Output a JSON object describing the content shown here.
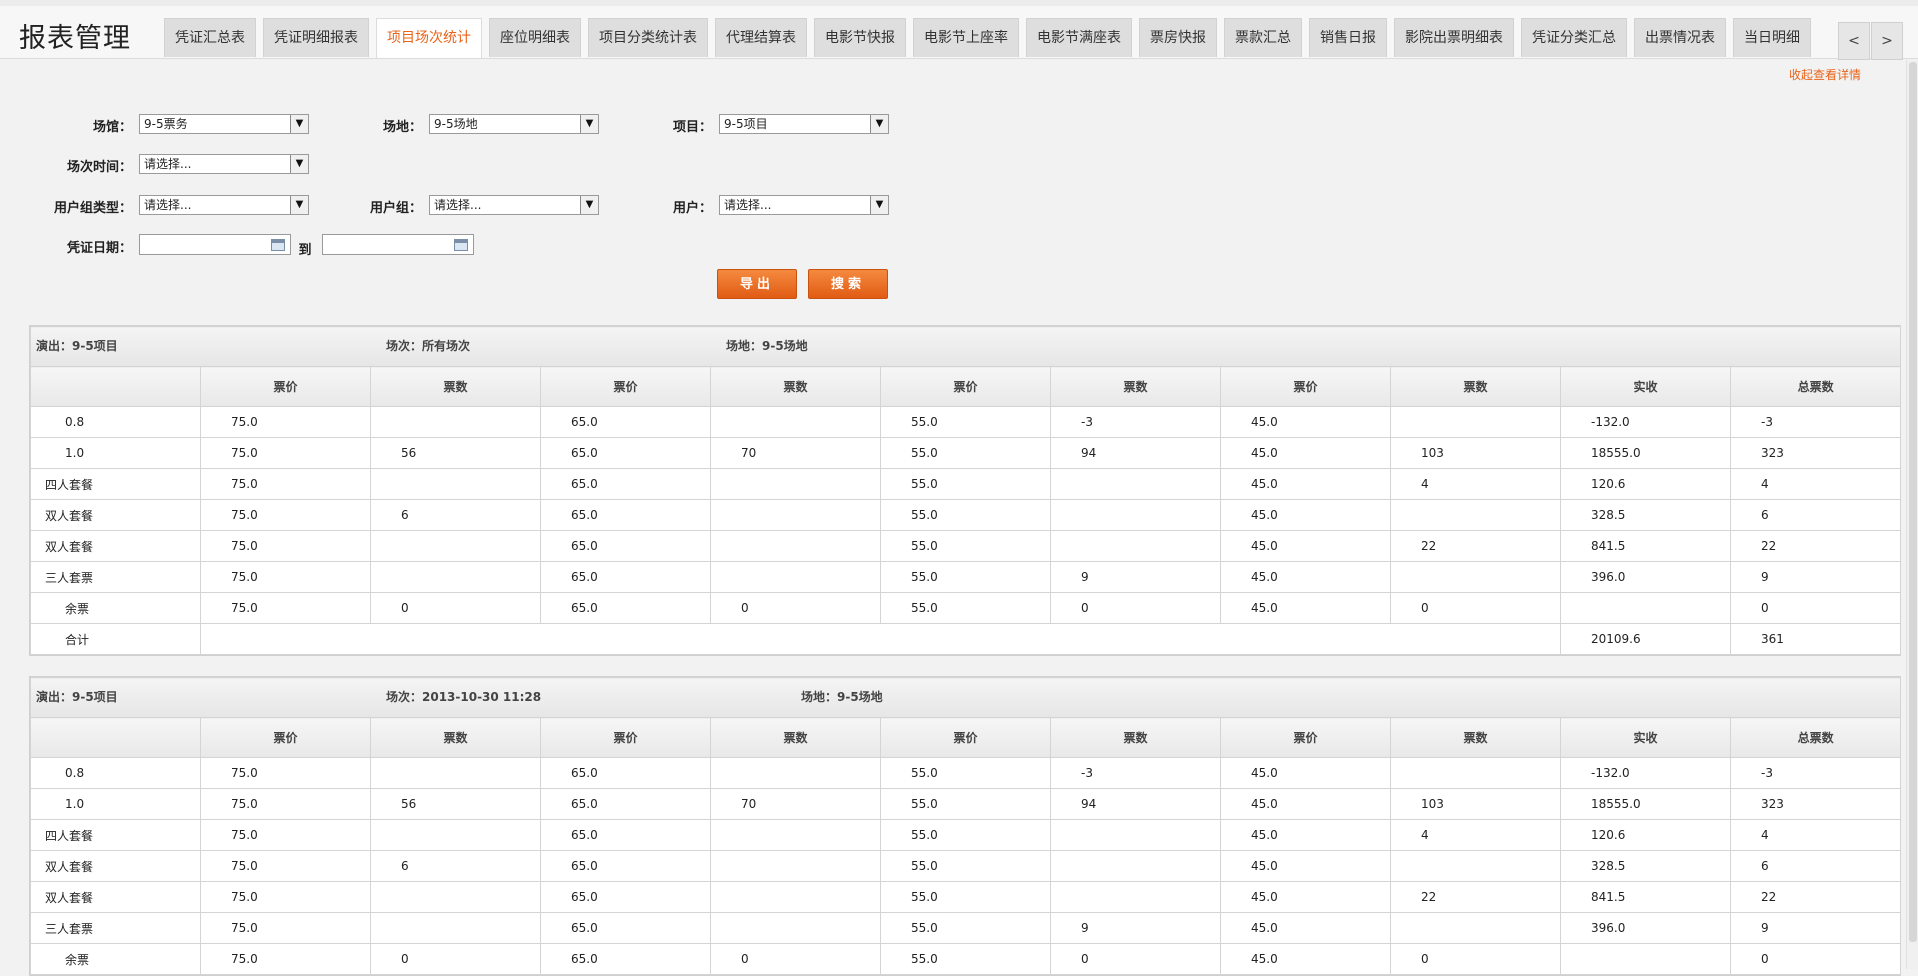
{
  "app_title": "报表管理",
  "tabs": [
    {
      "label": "凭证汇总表",
      "active": false
    },
    {
      "label": "凭证明细报表",
      "active": false
    },
    {
      "label": "项目场次统计",
      "active": true
    },
    {
      "label": "座位明细表",
      "active": false
    },
    {
      "label": "项目分类统计表",
      "active": false
    },
    {
      "label": "代理结算表",
      "active": false
    },
    {
      "label": "电影节快报",
      "active": false
    },
    {
      "label": "电影节上座率",
      "active": false
    },
    {
      "label": "电影节满座表",
      "active": false
    },
    {
      "label": "票房快报",
      "active": false
    },
    {
      "label": "票款汇总",
      "active": false
    },
    {
      "label": "销售日报",
      "active": false
    },
    {
      "label": "影院出票明细表",
      "active": false
    },
    {
      "label": "凭证分类汇总",
      "active": false
    },
    {
      "label": "出票情况表",
      "active": false
    },
    {
      "label": "当日明细",
      "active": false
    }
  ],
  "tab_prev": "<",
  "tab_next": ">",
  "toggle_link": "收起查看详情",
  "filters": {
    "venue_label": "场馆：",
    "venue_value": "9-5票务",
    "site_label": "场地：",
    "site_value": "9-5场地",
    "project_label": "项目：",
    "project_value": "9-5项目",
    "session_label": "场次时间：",
    "session_value": "请选择...",
    "usergroup_type_label": "用户组类型：",
    "usergroup_type_value": "请选择...",
    "usergroup_label": "用户组：",
    "usergroup_value": "请选择...",
    "user_label": "用户：",
    "user_value": "请选择...",
    "date_label": "凭证日期：",
    "date_to": "到",
    "date_from_value": "",
    "date_to_value": "",
    "export_button": "导出",
    "search_button": "搜索"
  },
  "columns": [
    "",
    "票价",
    "票数",
    "票价",
    "票数",
    "票价",
    "票数",
    "票价",
    "票数",
    "实收",
    "总票数"
  ],
  "reports": [
    {
      "show_label": "演出：9-5项目",
      "session_label": "场次：所有场次",
      "site_label": "场地：9-5场地",
      "rows": [
        [
          "0.8",
          "75.0",
          "",
          "65.0",
          "",
          "55.0",
          "-3",
          "45.0",
          "",
          "-132.0",
          "-3"
        ],
        [
          "1.0",
          "75.0",
          "56",
          "65.0",
          "70",
          "55.0",
          "94",
          "45.0",
          "103",
          "18555.0",
          "323"
        ],
        [
          "四人套餐",
          "75.0",
          "",
          "65.0",
          "",
          "55.0",
          "",
          "45.0",
          "4",
          "120.6",
          "4"
        ],
        [
          "双人套餐",
          "75.0",
          "6",
          "65.0",
          "",
          "55.0",
          "",
          "45.0",
          "",
          "328.5",
          "6"
        ],
        [
          "双人套餐",
          "75.0",
          "",
          "65.0",
          "",
          "55.0",
          "",
          "45.0",
          "22",
          "841.5",
          "22"
        ],
        [
          "三人套票",
          "75.0",
          "",
          "65.0",
          "",
          "55.0",
          "9",
          "45.0",
          "",
          "396.0",
          "9"
        ],
        [
          "余票",
          "75.0",
          "0",
          "65.0",
          "0",
          "55.0",
          "0",
          "45.0",
          "0",
          "",
          "0"
        ]
      ],
      "total": {
        "label": "合计",
        "amount": "20109.6",
        "count": "361"
      }
    },
    {
      "show_label": "演出：9-5项目",
      "session_label": "场次：2013-10-30 11:28",
      "site_label": "场地：9-5场地",
      "rows": [
        [
          "0.8",
          "75.0",
          "",
          "65.0",
          "",
          "55.0",
          "-3",
          "45.0",
          "",
          "-132.0",
          "-3"
        ],
        [
          "1.0",
          "75.0",
          "56",
          "65.0",
          "70",
          "55.0",
          "94",
          "45.0",
          "103",
          "18555.0",
          "323"
        ],
        [
          "四人套餐",
          "75.0",
          "",
          "65.0",
          "",
          "55.0",
          "",
          "45.0",
          "4",
          "120.6",
          "4"
        ],
        [
          "双人套餐",
          "75.0",
          "6",
          "65.0",
          "",
          "55.0",
          "",
          "45.0",
          "",
          "328.5",
          "6"
        ],
        [
          "双人套餐",
          "75.0",
          "",
          "65.0",
          "",
          "55.0",
          "",
          "45.0",
          "22",
          "841.5",
          "22"
        ],
        [
          "三人套票",
          "75.0",
          "",
          "65.0",
          "",
          "55.0",
          "9",
          "45.0",
          "",
          "396.0",
          "9"
        ],
        [
          "余票",
          "75.0",
          "0",
          "65.0",
          "0",
          "55.0",
          "0",
          "45.0",
          "0",
          "",
          "0"
        ]
      ]
    }
  ]
}
